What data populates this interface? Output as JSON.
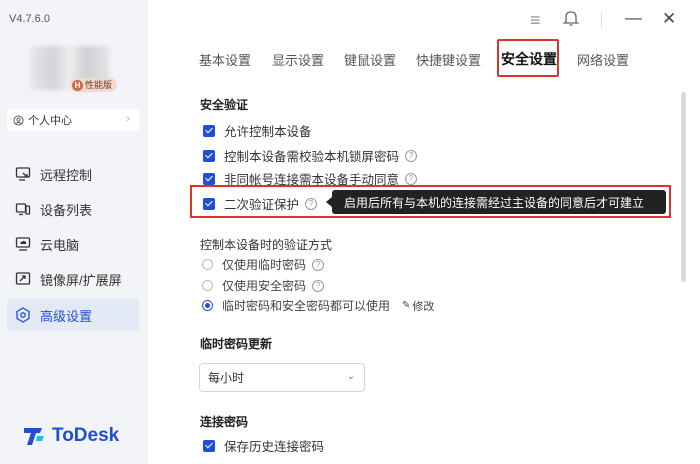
{
  "app": {
    "version": "V4.7.6.0",
    "brand": "ToDesk",
    "accent_color": "#1f4fd6",
    "highlight_color": "#d9352a"
  },
  "sidebar": {
    "vip_badge": "性能版",
    "vip_badge_letter": "H",
    "profile_label": "个人中心",
    "items": [
      {
        "label": "远程控制",
        "icon": "remote-control-icon"
      },
      {
        "label": "设备列表",
        "icon": "device-list-icon"
      },
      {
        "label": "云电脑",
        "icon": "cloud-pc-icon"
      },
      {
        "label": "镜像屏/扩展屏",
        "icon": "mirror-screen-icon"
      },
      {
        "label": "高级设置",
        "icon": "advanced-settings-icon",
        "active": true
      }
    ]
  },
  "window": {
    "controls": [
      "menu-icon",
      "bell-icon",
      "minimize-icon",
      "close-icon"
    ],
    "menu_glyph": "≡",
    "minimize_glyph": "—",
    "close_glyph": "✕"
  },
  "tabs": [
    "基本设置",
    "显示设置",
    "键鼠设置",
    "快捷键设置",
    "安全设置",
    "网络设置"
  ],
  "active_tab": "安全设置",
  "security": {
    "title": "安全验证",
    "options": [
      {
        "label": "允许控制本设备",
        "checked": true,
        "help": false
      },
      {
        "label": "控制本设备需校验本机锁屏密码",
        "checked": true,
        "help": true
      },
      {
        "label": "非同帐号连接需本设备手动同意",
        "checked": true,
        "help": true
      },
      {
        "label": "二次验证保护",
        "checked": true,
        "help": true
      }
    ],
    "tooltip": "启用后所有与本机的连接需经过主设备的同意后才可建立",
    "help_glyph": "?"
  },
  "verify_method": {
    "title": "控制本设备时的验证方式",
    "options": [
      {
        "label": "仅使用临时密码",
        "selected": false,
        "help": true
      },
      {
        "label": "仅使用安全密码",
        "selected": false,
        "help": true
      },
      {
        "label": "临时密码和安全密码都可以使用",
        "selected": true,
        "help": false
      }
    ],
    "edit_label": "修改"
  },
  "temp_password": {
    "title": "临时密码更新",
    "selected": "每小时"
  },
  "connection_password": {
    "title": "连接密码",
    "options": [
      {
        "label": "保存历史连接密码",
        "checked": true
      }
    ]
  }
}
